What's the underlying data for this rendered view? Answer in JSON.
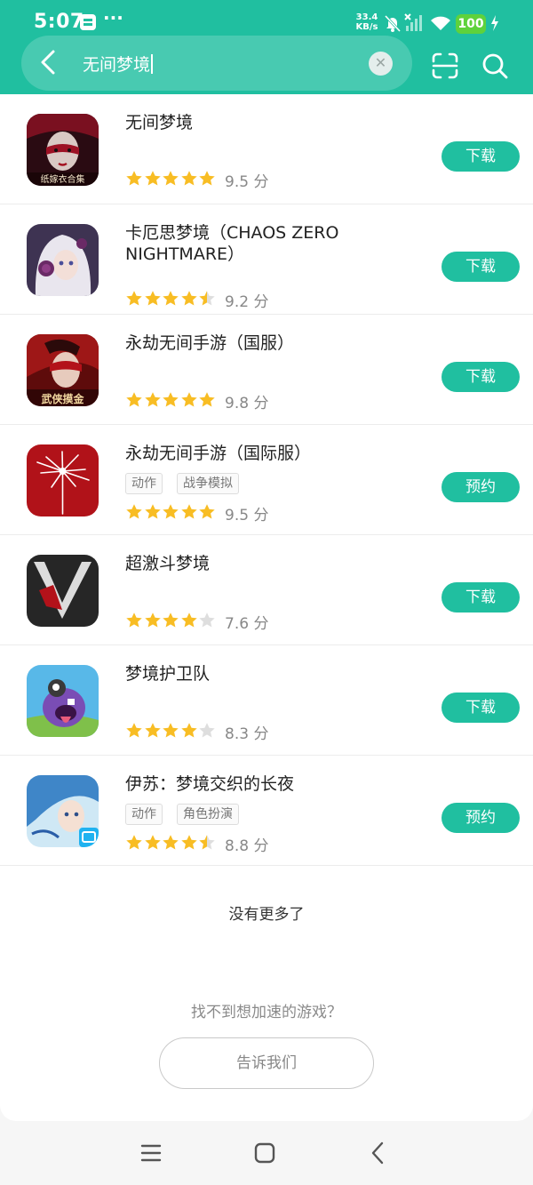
{
  "status_bar": {
    "time": "5:07",
    "dots": "···",
    "speed_value": "33.4",
    "speed_unit": "KB/s",
    "battery": "100"
  },
  "search": {
    "query": "无间梦境"
  },
  "colors": {
    "accent": "#20bfa0",
    "star_filled": "#f8bd24",
    "star_empty": "#dedede"
  },
  "games": [
    {
      "title": "无间梦境",
      "tags": [],
      "rating": 5,
      "score": "9.5 分",
      "button": "下载",
      "icon": "dark-theatre-mask-icon",
      "icon_caption": "纸嫁衣合集"
    },
    {
      "title": "卡厄思梦境（CHAOS ZERO NIGHTMARE）",
      "tags": [],
      "rating": 4.5,
      "score": "9.2 分",
      "button": "下载",
      "icon": "white-haired-girl-icon"
    },
    {
      "title": "永劫无间手游（国服）",
      "tags": [],
      "rating": 5,
      "score": "9.8 分",
      "button": "下载",
      "icon": "masked-warrior-icon",
      "icon_caption": "武侠摸金"
    },
    {
      "title": "永劫无间手游（国际服）",
      "tags": [
        "动作",
        "战争模拟"
      ],
      "rating": 5,
      "score": "9.5 分",
      "button": "预约",
      "icon": "red-spider-lily-icon"
    },
    {
      "title": "超激斗梦境",
      "tags": [],
      "rating": 4,
      "score": "7.6 分",
      "button": "下载",
      "icon": "silver-v-logo-icon"
    },
    {
      "title": "梦境护卫队",
      "tags": [],
      "rating": 4,
      "score": "8.3 分",
      "button": "下载",
      "icon": "purple-monster-icon"
    },
    {
      "title": "伊苏：梦境交织的长夜",
      "tags": [
        "动作",
        "角色扮演"
      ],
      "rating": 4.5,
      "score": "8.8 分",
      "button": "预约",
      "icon": "blue-haired-hero-icon"
    }
  ],
  "footer": {
    "no_more": "没有更多了",
    "not_found": "找不到想加速的游戏？",
    "tell_us": "告诉我们"
  }
}
